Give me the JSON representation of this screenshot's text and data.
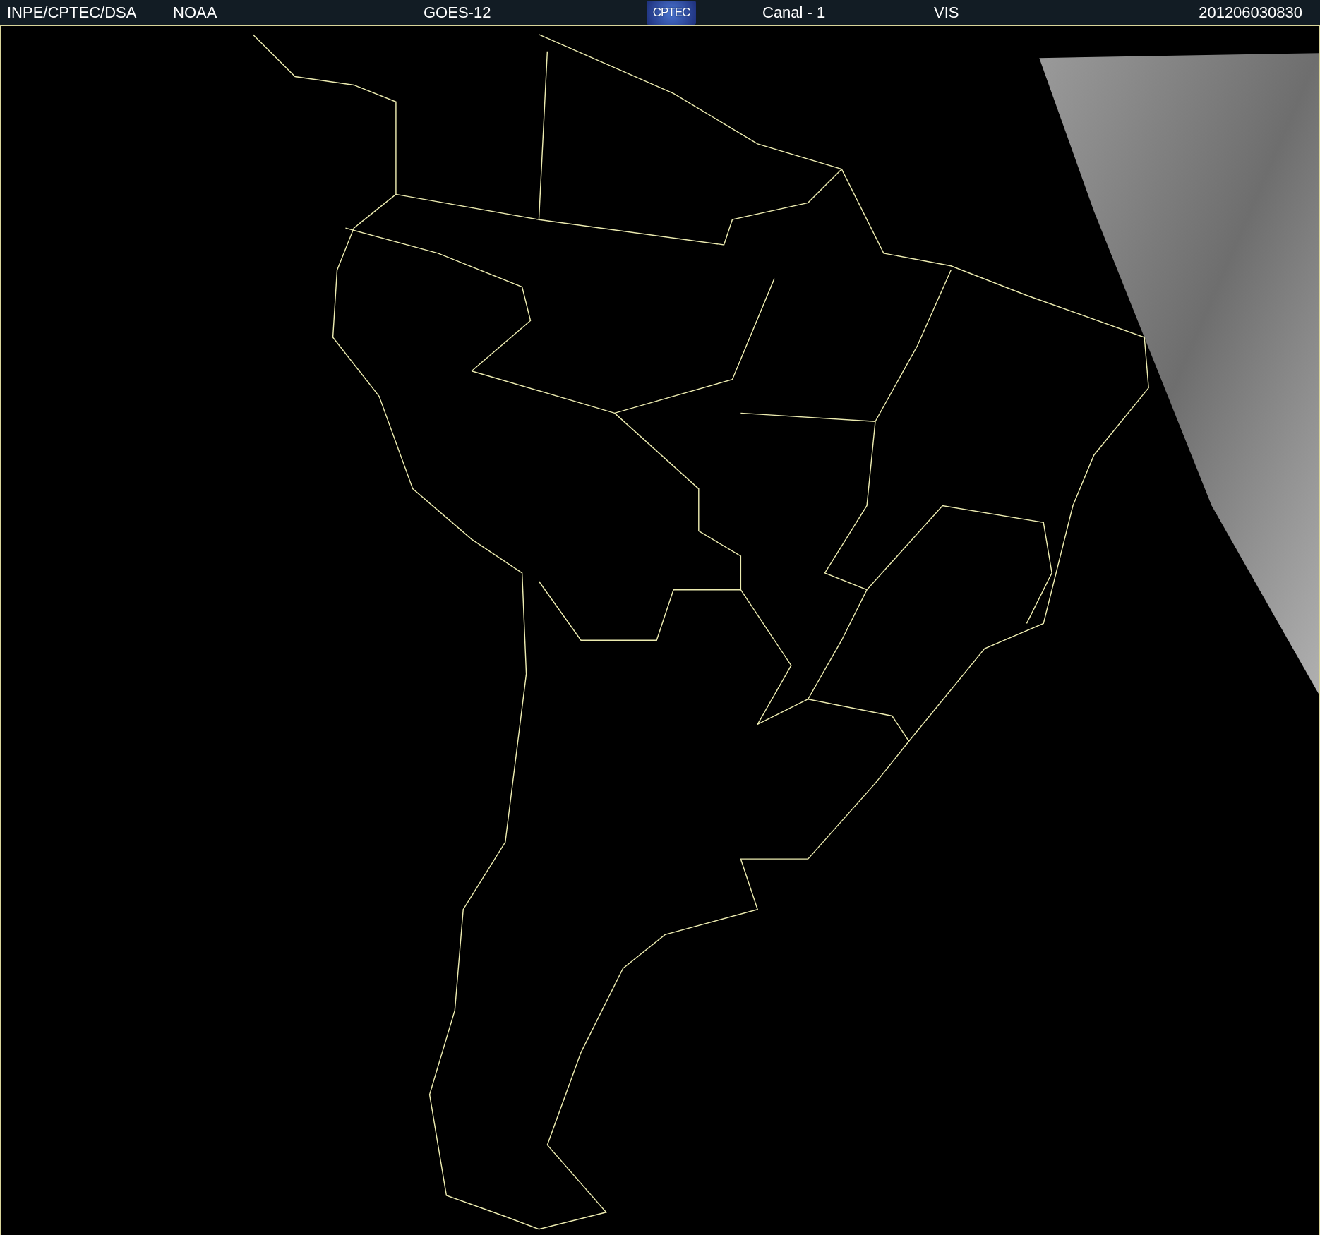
{
  "header": {
    "items": [
      {
        "kind": "text",
        "label": "INPE/CPTEC/DSA"
      },
      {
        "kind": "text",
        "label": "NOAA"
      },
      {
        "kind": "text",
        "label": "GOES-12"
      },
      {
        "kind": "logo",
        "label": "CPTEC"
      },
      {
        "kind": "text",
        "label": "Canal - 1"
      },
      {
        "kind": "text",
        "label": "VIS"
      },
      {
        "kind": "date",
        "label": "201206030830"
      }
    ]
  }
}
